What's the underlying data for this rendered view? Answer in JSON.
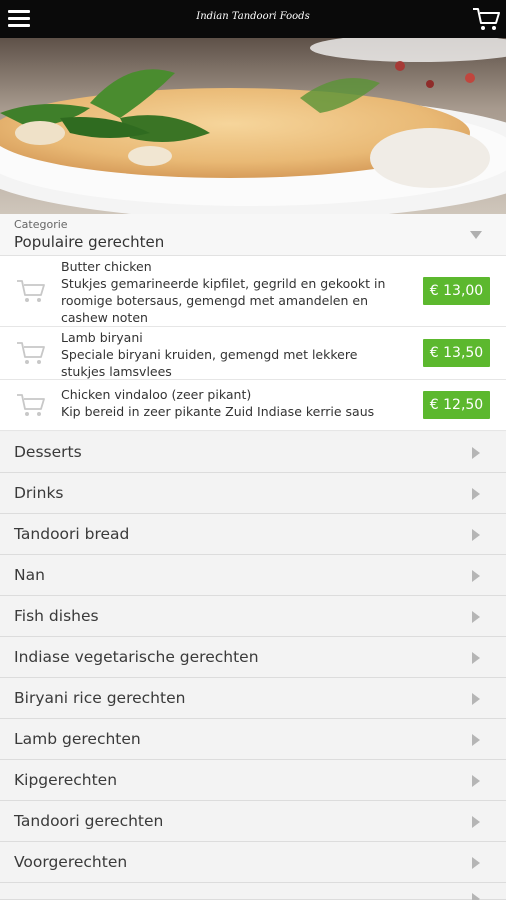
{
  "header": {
    "title": "Indian Tandoori Foods",
    "menu_icon": "menu-icon",
    "cart_icon": "cart-icon"
  },
  "category": {
    "label": "Categorie",
    "selected": "Populaire gerechten"
  },
  "popular_items": [
    {
      "name": "Butter chicken",
      "description": "Stukjes gemarineerde kipfilet, gegrild en gekookt in roomige botersaus, gemengd met amandelen en cashew noten",
      "price": "€ 13,00"
    },
    {
      "name": "Lamb biryani",
      "description": "Speciale biryani kruiden, gemengd met lekkere stukjes lamsvlees",
      "price": "€ 13,50"
    },
    {
      "name": "Chicken vindaloo (zeer pikant)",
      "description": "Kip bereid in zeer pikante Zuid Indiase kerrie saus",
      "price": "€ 12,50"
    }
  ],
  "categories": [
    "Desserts",
    "Drinks",
    "Tandoori bread",
    "Nan",
    "Fish dishes",
    "Indiase vegetarische gerechten",
    "Biryani rice gerechten",
    "Lamb gerechten",
    "Kipgerechten",
    "Tandoori gerechten",
    "Voorgerechten"
  ],
  "colors": {
    "price_green": "#5cb82e",
    "topbar": "#0a0a0a"
  }
}
